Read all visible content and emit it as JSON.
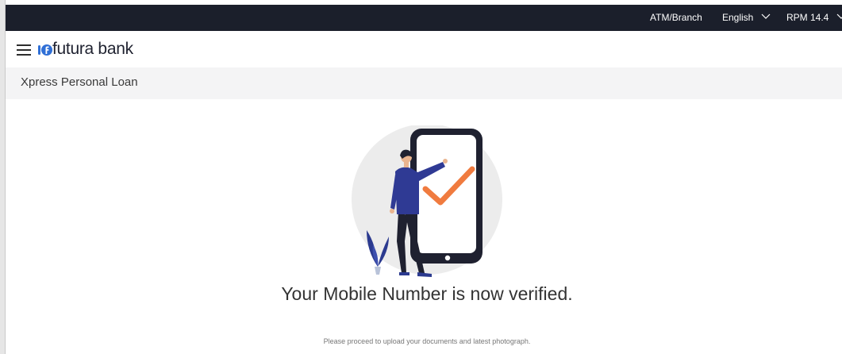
{
  "topbar": {
    "atm_branch": "ATM/Branch",
    "language": "English",
    "user": "RPM 14.4"
  },
  "header": {
    "brand": "futura bank",
    "menu_icon": "hamburger-menu-icon",
    "logo_icon": "futura-bank-logo-icon"
  },
  "page": {
    "title": "Xpress Personal Loan"
  },
  "content": {
    "illustration": "mobile-verified-illustration",
    "message": "Your Mobile Number is now verified.",
    "submessage": "Please proceed to upload your documents and latest photograph."
  },
  "colors": {
    "topbar_bg": "#1b1f2b",
    "logo_blue": "#2f6fd6",
    "check_orange": "#f07b3f",
    "subheader_bg": "#f4f4f5"
  }
}
